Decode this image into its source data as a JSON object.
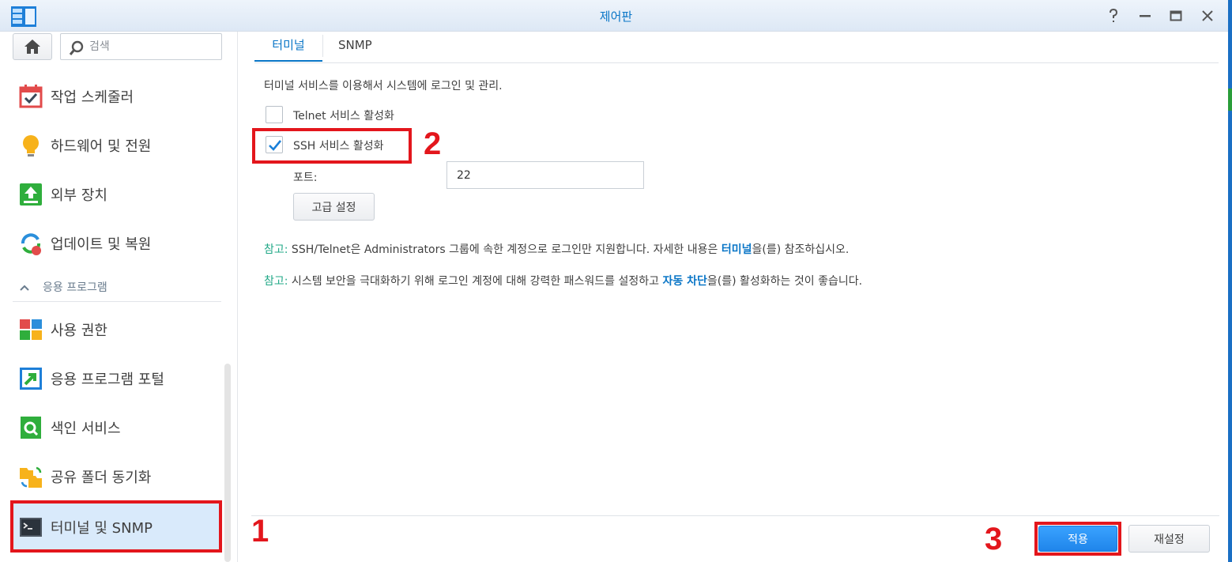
{
  "window": {
    "title": "제어판",
    "controls": [
      "help-icon",
      "minimize-icon",
      "maximize-icon",
      "close-icon"
    ]
  },
  "sidebar": {
    "search_placeholder": "검색",
    "items_top": [
      {
        "label": "작업 스케줄러",
        "icon": "calendar-check-icon"
      },
      {
        "label": "하드웨어 및 전원",
        "icon": "lightbulb-icon"
      },
      {
        "label": "외부 장치",
        "icon": "external-device-icon"
      },
      {
        "label": "업데이트 및 복원",
        "icon": "update-restore-icon"
      }
    ],
    "section_label": "응용 프로그램",
    "items_apps": [
      {
        "label": "사용 권한",
        "icon": "privileges-icon"
      },
      {
        "label": "응용 프로그램 포털",
        "icon": "portal-icon"
      },
      {
        "label": "색인 서비스",
        "icon": "indexing-icon"
      },
      {
        "label": "공유 폴더 동기화",
        "icon": "folder-sync-icon"
      },
      {
        "label": "터미널 및 SNMP",
        "icon": "terminal-icon",
        "active": true
      }
    ]
  },
  "tabs": [
    {
      "label": "터미널",
      "active": true
    },
    {
      "label": "SNMP",
      "active": false
    }
  ],
  "terminal": {
    "description": "터미널 서비스를 이용해서 시스템에 로그인 및 관리.",
    "telnet_label": "Telnet 서비스 활성화",
    "telnet_checked": false,
    "ssh_label": "SSH 서비스 활성화",
    "ssh_checked": true,
    "port_label": "포트:",
    "port_value": "22",
    "advanced_button": "고급 설정"
  },
  "notes": [
    {
      "prefix": "참고:",
      "text_before": " SSH/Telnet은 Administrators 그룹에 속한 계정으로 로그인만 지원합니다. 자세한 내용은 ",
      "link": "터미널",
      "text_after": "을(를) 참조하십시오."
    },
    {
      "prefix": "참고:",
      "text_before": " 시스템 보안을 극대화하기 위해 로그인 계정에 대해 강력한 패스워드를 설정하고 ",
      "link": "자동 차단",
      "text_after": "을(를) 활성화하는 것이 좋습니다."
    }
  ],
  "footer": {
    "apply_label": "적용",
    "reset_label": "재설정"
  },
  "annotations": {
    "step1": "1",
    "step2": "2",
    "step3": "3",
    "color": "#e3161c"
  },
  "colors": {
    "accent": "#0a76c7",
    "note_prefix": "#21a887",
    "active_nav_bg": "#d9eafb"
  }
}
